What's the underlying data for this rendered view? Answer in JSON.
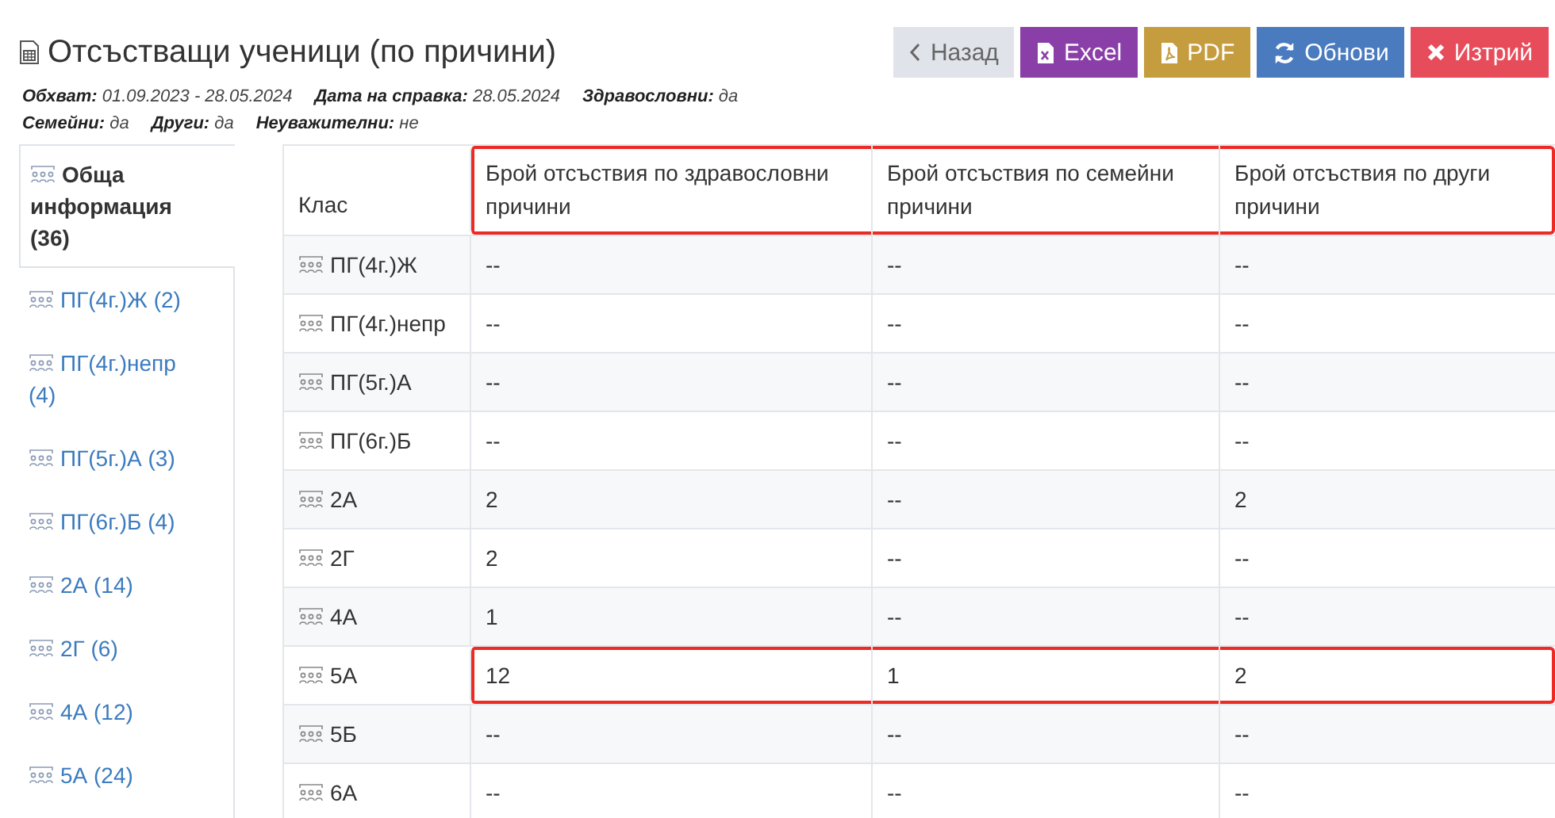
{
  "title": "Отсъстващи ученици (по причини)",
  "buttons": [
    {
      "kind": "back",
      "label": "Назад"
    },
    {
      "kind": "excel",
      "label": "Excel"
    },
    {
      "kind": "pdf",
      "label": "PDF"
    },
    {
      "kind": "refresh",
      "label": "Обнови"
    },
    {
      "kind": "delete",
      "label": "Изтрий"
    }
  ],
  "meta": [
    {
      "label": "Обхват:",
      "value": "01.09.2023 - 28.05.2024"
    },
    {
      "label": "Дата на справка:",
      "value": "28.05.2024"
    },
    {
      "label": "Здравословни:",
      "value": "да"
    },
    {
      "label": "Семейни:",
      "value": "да"
    },
    {
      "label": "Други:",
      "value": "да"
    },
    {
      "label": "Неуважителни:",
      "value": "не"
    }
  ],
  "sidebar": [
    {
      "label": "Обща информация (36)",
      "selected": true
    },
    {
      "label": "ПГ(4г.)Ж (2)",
      "selected": false
    },
    {
      "label": "ПГ(4г.)непр (4)",
      "selected": false
    },
    {
      "label": "ПГ(5г.)А (3)",
      "selected": false
    },
    {
      "label": "ПГ(6г.)Б (4)",
      "selected": false
    },
    {
      "label": "2А (14)",
      "selected": false
    },
    {
      "label": "2Г (6)",
      "selected": false
    },
    {
      "label": "4А (12)",
      "selected": false
    },
    {
      "label": "5А (24)",
      "selected": false
    }
  ],
  "table": {
    "columns": [
      "Клас",
      "Брой отсъствия по здравословни причини",
      "Брой отсъствия по семейни причини",
      "Брой отсъствия по други причини"
    ],
    "header_highlighted": true,
    "rows": [
      {
        "class": "ПГ(4г.)Ж",
        "values": [
          "--",
          "--",
          "--"
        ],
        "highlighted": false
      },
      {
        "class": "ПГ(4г.)непр",
        "values": [
          "--",
          "--",
          "--"
        ],
        "highlighted": false
      },
      {
        "class": "ПГ(5г.)А",
        "values": [
          "--",
          "--",
          "--"
        ],
        "highlighted": false
      },
      {
        "class": "ПГ(6г.)Б",
        "values": [
          "--",
          "--",
          "--"
        ],
        "highlighted": false
      },
      {
        "class": "2А",
        "values": [
          "2",
          "--",
          "2"
        ],
        "highlighted": false
      },
      {
        "class": "2Г",
        "values": [
          "2",
          "--",
          "--"
        ],
        "highlighted": false
      },
      {
        "class": "4А",
        "values": [
          "1",
          "--",
          "--"
        ],
        "highlighted": false
      },
      {
        "class": "5А",
        "values": [
          "12",
          "1",
          "2"
        ],
        "highlighted": true
      },
      {
        "class": "5Б",
        "values": [
          "--",
          "--",
          "--"
        ],
        "highlighted": false
      },
      {
        "class": "6А",
        "values": [
          "--",
          "--",
          "--"
        ],
        "highlighted": false
      }
    ]
  }
}
